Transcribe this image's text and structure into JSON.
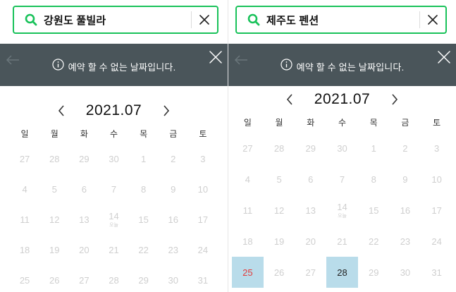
{
  "left": {
    "search": {
      "query": "강원도 풀빌라",
      "icon": "search-icon",
      "clear_icon": "close-icon"
    },
    "toast": {
      "message": "예약 할 수 없는 날짜입니다.",
      "icon": "info-circle-icon"
    },
    "calendar": {
      "month": "2021.07",
      "weekdays": [
        "일",
        "월",
        "화",
        "수",
        "목",
        "금",
        "토"
      ],
      "days": [
        [
          "27",
          "28",
          "29",
          "30",
          "1",
          "2",
          "3"
        ],
        [
          "4",
          "5",
          "6",
          "7",
          "8",
          "9",
          "10"
        ],
        [
          "11",
          "12",
          "13",
          "14",
          "15",
          "16",
          "17"
        ],
        [
          "18",
          "19",
          "20",
          "21",
          "22",
          "23",
          "24"
        ],
        [
          "25",
          "26",
          "27",
          "28",
          "29",
          "30",
          "31"
        ]
      ],
      "holiday_note": "오늘"
    }
  },
  "right": {
    "search": {
      "query": "제주도 펜션",
      "icon": "search-icon",
      "clear_icon": "close-icon"
    },
    "toast": {
      "message": "예약 할 수 없는 날짜입니다.",
      "icon": "info-circle-icon"
    },
    "calendar": {
      "month": "2021.07",
      "weekdays": [
        "일",
        "월",
        "화",
        "수",
        "목",
        "금",
        "토"
      ],
      "days": [
        [
          "27",
          "28",
          "29",
          "30",
          "1",
          "2",
          "3"
        ],
        [
          "4",
          "5",
          "6",
          "7",
          "8",
          "9",
          "10"
        ],
        [
          "11",
          "12",
          "13",
          "14",
          "15",
          "16",
          "17"
        ],
        [
          "18",
          "19",
          "20",
          "21",
          "22",
          "23",
          "24"
        ],
        [
          "25",
          "26",
          "27",
          "28",
          "29",
          "30",
          "31"
        ]
      ],
      "holiday_note": "오늘",
      "selected": [
        "25",
        "28"
      ]
    }
  },
  "colors": {
    "search_border": "#19c25a",
    "toast_bg": "#4a555a",
    "selected_bg": "#b9dcea",
    "selected_sunday": "#e23b3b",
    "disabled_day": "#cfcfcf"
  }
}
